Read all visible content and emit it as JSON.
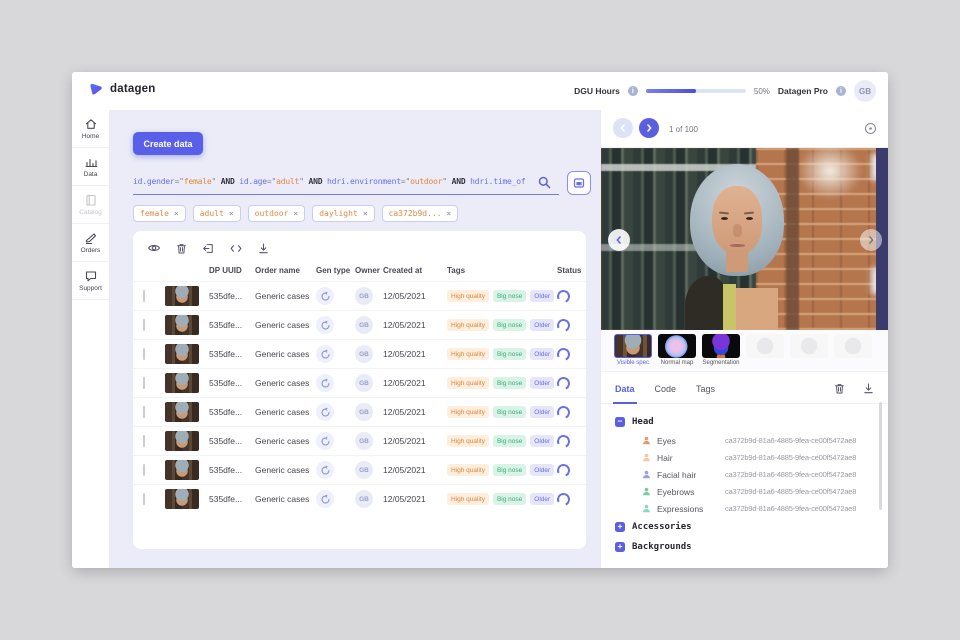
{
  "colors": {
    "accent": "#5a5fe0",
    "main_bg": "#ebecf8",
    "orange": "#e0863c",
    "tag_orange_bg": "#fdeede",
    "tag_green_bg": "#d9f3e6",
    "tag_green_text": "#3bab7c",
    "tag_purple_bg": "#e5e6f9",
    "tag_purple_text": "#6a6fe8"
  },
  "header": {
    "logo_text": "datagen",
    "dgu_label": "DGU Hours",
    "dgu_percent": "50%",
    "progress": 50,
    "plan_label": "Datagen Pro",
    "avatar_initials": "GB"
  },
  "sidebar": {
    "items": [
      {
        "label": "Home",
        "icon": "home-icon",
        "state": "default"
      },
      {
        "label": "Data",
        "icon": "data-icon",
        "state": "active"
      },
      {
        "label": "Catalog",
        "icon": "catalog-icon",
        "state": "disabled"
      },
      {
        "label": "Orders",
        "icon": "orders-icon",
        "state": "default"
      },
      {
        "label": "Support",
        "icon": "support-icon",
        "state": "default"
      }
    ]
  },
  "main": {
    "create_button": "Create data",
    "query": {
      "segments": [
        {
          "text": "id.gender",
          "type": "key"
        },
        {
          "text": "=\"",
          "type": "op"
        },
        {
          "text": "female",
          "type": "val"
        },
        {
          "text": "\"",
          "type": "op"
        },
        {
          "text": " AND ",
          "type": "kw"
        },
        {
          "text": "id.age",
          "type": "key"
        },
        {
          "text": "=\"",
          "type": "op"
        },
        {
          "text": "adult",
          "type": "val"
        },
        {
          "text": "\"",
          "type": "op"
        },
        {
          "text": " AND ",
          "type": "kw"
        },
        {
          "text": "hdri.environment",
          "type": "key"
        },
        {
          "text": "=\"",
          "type": "op"
        },
        {
          "text": "outdoor",
          "type": "val"
        },
        {
          "text": "\"",
          "type": "op"
        },
        {
          "text": " AND ",
          "type": "kw"
        },
        {
          "text": "hdri.time_of",
          "type": "key"
        }
      ],
      "search_icon": "search-icon",
      "calendar_icon": "calendar-icon"
    },
    "chips": [
      {
        "label": "female"
      },
      {
        "label": "adult"
      },
      {
        "label": "outdoor"
      },
      {
        "label": "daylight"
      },
      {
        "label": "ca372b9d..."
      }
    ],
    "chip_close": "×",
    "toolbar_icons": [
      {
        "icon": "eye-icon"
      },
      {
        "icon": "trash-icon"
      },
      {
        "icon": "export-icon"
      },
      {
        "icon": "code-icon"
      },
      {
        "icon": "download-icon"
      }
    ],
    "table": {
      "columns": [
        "DP UUID",
        "Order name",
        "Gen type",
        "Owner",
        "Created at",
        "Tags",
        "Status"
      ],
      "row_count": 8,
      "row": {
        "uuid": "535dfe...",
        "order_name": "Generic cases",
        "gen_type_icon": "regenerate-icon",
        "owner": "GB",
        "created_at": "12/05/2021",
        "tags": [
          {
            "label": "High quality",
            "color": "orange"
          },
          {
            "label": "Big nose",
            "color": "green"
          },
          {
            "label": "Older",
            "color": "purple"
          }
        ]
      }
    }
  },
  "preview": {
    "pagination_label": "1 of 100",
    "prev_icon": "chevron-left-icon",
    "next_icon": "chevron-right-icon",
    "target_icon": "target-icon",
    "thumbnails": [
      {
        "label": "Visible spec",
        "type": "photo",
        "selected": true
      },
      {
        "label": "Normal map",
        "type": "normal",
        "selected": false
      },
      {
        "label": "Segmentation",
        "type": "segmentation",
        "selected": false
      },
      {
        "label": "",
        "type": "ghost",
        "selected": false
      },
      {
        "label": "",
        "type": "ghost",
        "selected": false
      },
      {
        "label": "",
        "type": "ghost",
        "selected": false
      }
    ],
    "tabs": [
      {
        "label": "Data",
        "active": true
      },
      {
        "label": "Code",
        "active": false
      },
      {
        "label": "Tags",
        "active": false
      }
    ],
    "tab_icons": [
      {
        "icon": "trash-icon"
      },
      {
        "icon": "download-icon"
      }
    ],
    "tree": {
      "sections": [
        {
          "label": "Head",
          "expanded": true,
          "children": [
            {
              "label": "Eyes",
              "icon": "person-icon",
              "tint": "#e59b6e",
              "value": "ca372b9d-81a6-4885-9fea-ce00f5472ae8"
            },
            {
              "label": "Hair",
              "icon": "person-icon",
              "tint": "#f3c9a0",
              "value": "ca372b9d-81a6-4885-9fea-ce00f5472ae8"
            },
            {
              "label": "Facial hair",
              "icon": "person-icon",
              "tint": "#9aa0e8",
              "value": "ca372b9d-81a6-4885-9fea-ce00f5472ae8"
            },
            {
              "label": "Eyebrows",
              "icon": "person-icon",
              "tint": "#7cc9a6",
              "value": "ca372b9d-81a6-4885-9fea-ce00f5472ae8"
            },
            {
              "label": "Expressions",
              "icon": "person-icon",
              "tint": "#8fd4c4",
              "value": "ca372b9d-81a6-4885-9fea-ce00f5472ae8"
            }
          ]
        },
        {
          "label": "Accessories",
          "expanded": false,
          "children": []
        },
        {
          "label": "Backgrounds",
          "expanded": false,
          "children": []
        }
      ]
    }
  }
}
